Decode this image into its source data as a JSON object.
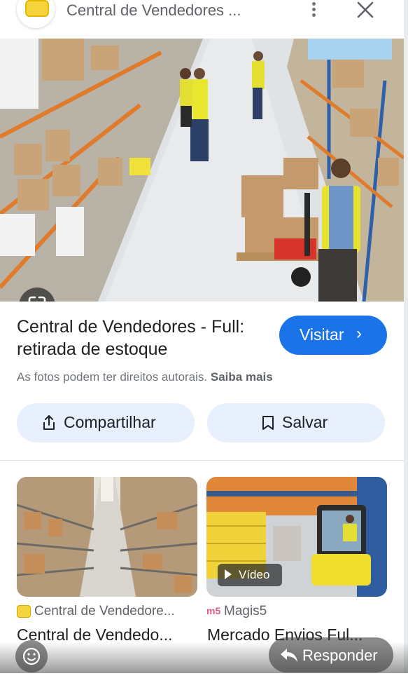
{
  "header": {
    "title": "Central de Vendedores ...",
    "menu_icon": "more-vert-icon",
    "close_icon": "close-icon"
  },
  "hero": {
    "lens_icon": "google-lens-icon"
  },
  "result": {
    "title": "Central de Vendedores - Full: retirada de estoque",
    "visit_label": "Visitar",
    "visit_chevron": "›",
    "copyright_text": "As fotos podem ter direitos autorais.",
    "learn_more": "Saiba mais",
    "share_label": "Compartilhar",
    "save_label": "Salvar"
  },
  "related": [
    {
      "source": "Central de Vendedore...",
      "caption": "Central de Vendedo..."
    },
    {
      "source": "Magis5",
      "caption": "Mercado Envios Ful...",
      "badge": "Vídeo"
    }
  ],
  "footer": {
    "reply_label": "Responder"
  },
  "colors": {
    "accent": "#1a73e8",
    "pill_bg": "#e8f0fe",
    "brand_yellow": "#f4d43a"
  }
}
